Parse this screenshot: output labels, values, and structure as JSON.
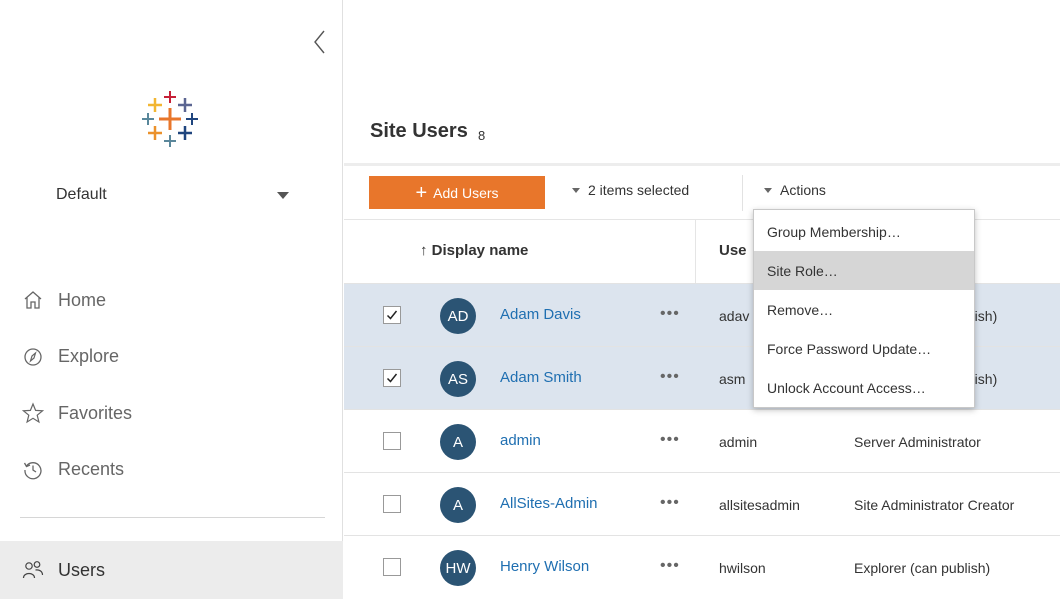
{
  "sidebar": {
    "site_name": "Default",
    "nav": [
      {
        "label": "Home",
        "icon": "home-icon"
      },
      {
        "label": "Explore",
        "icon": "compass-icon"
      },
      {
        "label": "Favorites",
        "icon": "star-icon"
      },
      {
        "label": "Recents",
        "icon": "history-icon"
      }
    ],
    "users_label": "Users"
  },
  "page": {
    "title": "Site Users",
    "count": "8"
  },
  "toolbar": {
    "add_label": "Add Users",
    "selection_label": "2 items selected",
    "actions_label": "Actions"
  },
  "table": {
    "headers": {
      "display_name": "↑ Display name",
      "username": "Use"
    },
    "rows": [
      {
        "initials": "AD",
        "name": "Adam Davis",
        "login": "adav",
        "role": "ublish)",
        "selected": true
      },
      {
        "initials": "AS",
        "name": "Adam Smith",
        "login": "asm",
        "role": "ublish)",
        "selected": true
      },
      {
        "initials": "A",
        "name": "admin",
        "login": "admin",
        "role": "Server Administrator",
        "selected": false
      },
      {
        "initials": "A",
        "name": "AllSites-Admin",
        "login": "allsitesadmin",
        "role": "Site Administrator Creator",
        "selected": false
      },
      {
        "initials": "HW",
        "name": "Henry Wilson",
        "login": "hwilson",
        "role": "Explorer (can publish)",
        "selected": false
      }
    ],
    "more_glyph": "•••"
  },
  "actions_menu": {
    "items": [
      "Group Membership…",
      "Site Role…",
      "Remove…",
      "Force Password Update…",
      "Unlock Account Access…"
    ],
    "highlighted_index": 1
  },
  "colors": {
    "accent": "#e8762b",
    "avatar": "#2b5474",
    "link": "#1f6fb1",
    "selected_row": "#dce4ee"
  }
}
